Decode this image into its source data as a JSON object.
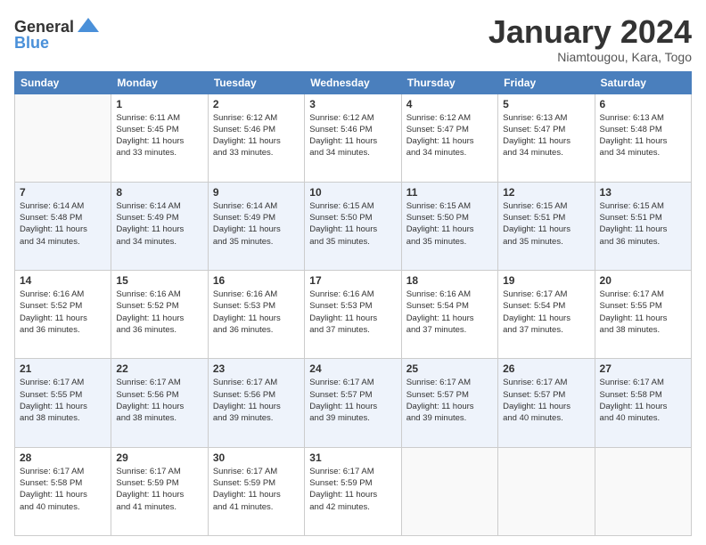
{
  "logo": {
    "general": "General",
    "blue": "Blue"
  },
  "header": {
    "month": "January 2024",
    "location": "Niamtougou, Kara, Togo"
  },
  "days_of_week": [
    "Sunday",
    "Monday",
    "Tuesday",
    "Wednesday",
    "Thursday",
    "Friday",
    "Saturday"
  ],
  "weeks": [
    [
      {
        "day": "",
        "info": ""
      },
      {
        "day": "1",
        "info": "Sunrise: 6:11 AM\nSunset: 5:45 PM\nDaylight: 11 hours\nand 33 minutes."
      },
      {
        "day": "2",
        "info": "Sunrise: 6:12 AM\nSunset: 5:46 PM\nDaylight: 11 hours\nand 33 minutes."
      },
      {
        "day": "3",
        "info": "Sunrise: 6:12 AM\nSunset: 5:46 PM\nDaylight: 11 hours\nand 34 minutes."
      },
      {
        "day": "4",
        "info": "Sunrise: 6:12 AM\nSunset: 5:47 PM\nDaylight: 11 hours\nand 34 minutes."
      },
      {
        "day": "5",
        "info": "Sunrise: 6:13 AM\nSunset: 5:47 PM\nDaylight: 11 hours\nand 34 minutes."
      },
      {
        "day": "6",
        "info": "Sunrise: 6:13 AM\nSunset: 5:48 PM\nDaylight: 11 hours\nand 34 minutes."
      }
    ],
    [
      {
        "day": "7",
        "info": "Sunrise: 6:14 AM\nSunset: 5:48 PM\nDaylight: 11 hours\nand 34 minutes."
      },
      {
        "day": "8",
        "info": "Sunrise: 6:14 AM\nSunset: 5:49 PM\nDaylight: 11 hours\nand 34 minutes."
      },
      {
        "day": "9",
        "info": "Sunrise: 6:14 AM\nSunset: 5:49 PM\nDaylight: 11 hours\nand 35 minutes."
      },
      {
        "day": "10",
        "info": "Sunrise: 6:15 AM\nSunset: 5:50 PM\nDaylight: 11 hours\nand 35 minutes."
      },
      {
        "day": "11",
        "info": "Sunrise: 6:15 AM\nSunset: 5:50 PM\nDaylight: 11 hours\nand 35 minutes."
      },
      {
        "day": "12",
        "info": "Sunrise: 6:15 AM\nSunset: 5:51 PM\nDaylight: 11 hours\nand 35 minutes."
      },
      {
        "day": "13",
        "info": "Sunrise: 6:15 AM\nSunset: 5:51 PM\nDaylight: 11 hours\nand 36 minutes."
      }
    ],
    [
      {
        "day": "14",
        "info": "Sunrise: 6:16 AM\nSunset: 5:52 PM\nDaylight: 11 hours\nand 36 minutes."
      },
      {
        "day": "15",
        "info": "Sunrise: 6:16 AM\nSunset: 5:52 PM\nDaylight: 11 hours\nand 36 minutes."
      },
      {
        "day": "16",
        "info": "Sunrise: 6:16 AM\nSunset: 5:53 PM\nDaylight: 11 hours\nand 36 minutes."
      },
      {
        "day": "17",
        "info": "Sunrise: 6:16 AM\nSunset: 5:53 PM\nDaylight: 11 hours\nand 37 minutes."
      },
      {
        "day": "18",
        "info": "Sunrise: 6:16 AM\nSunset: 5:54 PM\nDaylight: 11 hours\nand 37 minutes."
      },
      {
        "day": "19",
        "info": "Sunrise: 6:17 AM\nSunset: 5:54 PM\nDaylight: 11 hours\nand 37 minutes."
      },
      {
        "day": "20",
        "info": "Sunrise: 6:17 AM\nSunset: 5:55 PM\nDaylight: 11 hours\nand 38 minutes."
      }
    ],
    [
      {
        "day": "21",
        "info": "Sunrise: 6:17 AM\nSunset: 5:55 PM\nDaylight: 11 hours\nand 38 minutes."
      },
      {
        "day": "22",
        "info": "Sunrise: 6:17 AM\nSunset: 5:56 PM\nDaylight: 11 hours\nand 38 minutes."
      },
      {
        "day": "23",
        "info": "Sunrise: 6:17 AM\nSunset: 5:56 PM\nDaylight: 11 hours\nand 39 minutes."
      },
      {
        "day": "24",
        "info": "Sunrise: 6:17 AM\nSunset: 5:57 PM\nDaylight: 11 hours\nand 39 minutes."
      },
      {
        "day": "25",
        "info": "Sunrise: 6:17 AM\nSunset: 5:57 PM\nDaylight: 11 hours\nand 39 minutes."
      },
      {
        "day": "26",
        "info": "Sunrise: 6:17 AM\nSunset: 5:57 PM\nDaylight: 11 hours\nand 40 minutes."
      },
      {
        "day": "27",
        "info": "Sunrise: 6:17 AM\nSunset: 5:58 PM\nDaylight: 11 hours\nand 40 minutes."
      }
    ],
    [
      {
        "day": "28",
        "info": "Sunrise: 6:17 AM\nSunset: 5:58 PM\nDaylight: 11 hours\nand 40 minutes."
      },
      {
        "day": "29",
        "info": "Sunrise: 6:17 AM\nSunset: 5:59 PM\nDaylight: 11 hours\nand 41 minutes."
      },
      {
        "day": "30",
        "info": "Sunrise: 6:17 AM\nSunset: 5:59 PM\nDaylight: 11 hours\nand 41 minutes."
      },
      {
        "day": "31",
        "info": "Sunrise: 6:17 AM\nSunset: 5:59 PM\nDaylight: 11 hours\nand 42 minutes."
      },
      {
        "day": "",
        "info": ""
      },
      {
        "day": "",
        "info": ""
      },
      {
        "day": "",
        "info": ""
      }
    ]
  ]
}
